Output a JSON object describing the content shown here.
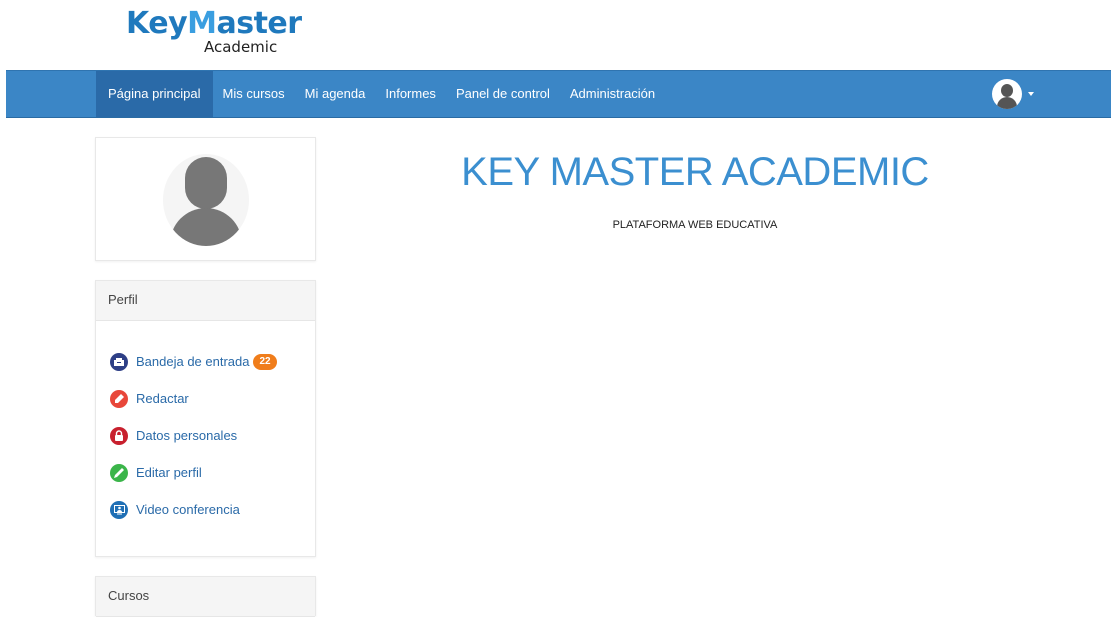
{
  "logo": {
    "main_prefix": "Key",
    "main_m": "M",
    "main_suffix": "aster",
    "sub": "Academic"
  },
  "nav": {
    "items": [
      {
        "label": "Página principal",
        "active": true
      },
      {
        "label": "Mis cursos"
      },
      {
        "label": "Mi agenda"
      },
      {
        "label": "Informes"
      },
      {
        "label": "Panel de control"
      },
      {
        "label": "Administración"
      }
    ],
    "bar_color": "#3b86c6",
    "active_color": "#2a6aa8"
  },
  "profile": {
    "header": "Perfil",
    "items": [
      {
        "label": "Bandeja de entrada",
        "icon": "inbox-icon",
        "icon_color": "#2e3f86",
        "badge": "22"
      },
      {
        "label": "Redactar",
        "icon": "compose-icon",
        "icon_color": "#e8473a"
      },
      {
        "label": "Datos personales",
        "icon": "lock-icon",
        "icon_color": "#c8202e"
      },
      {
        "label": "Editar perfil",
        "icon": "pencil-icon",
        "icon_color": "#3bb54a"
      },
      {
        "label": "Video conferencia",
        "icon": "video-conference-icon",
        "icon_color": "#1f6fb5"
      }
    ],
    "badge_color": "#f07d1b"
  },
  "courses": {
    "header": "Cursos"
  },
  "main": {
    "title": "KEY MASTER ACADEMIC",
    "subtitle": "PLATAFORMA WEB EDUCATIVA"
  }
}
